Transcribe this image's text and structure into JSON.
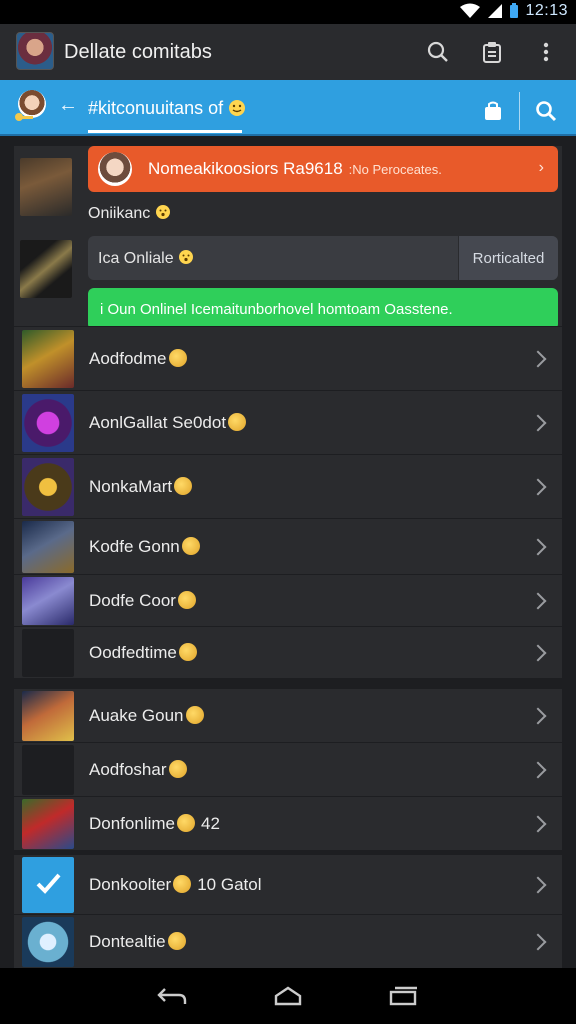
{
  "status": {
    "time": "12:13"
  },
  "appbar": {
    "title": "Dellate comitabs"
  },
  "tab": {
    "title": "#kitconuuitans of"
  },
  "banners": {
    "orange": {
      "title": "Nomeakikoosiors Ra9618",
      "sub": ":No Peroceates."
    },
    "online_label": "Oniikanc",
    "gray": {
      "text": "Ica Onliale",
      "button": "Rorticalted"
    },
    "green": {
      "text": "i Oun Onlinel Icemaitunborhovel homtoam Oasstene."
    }
  },
  "rows": [
    {
      "name": "Aodfodme",
      "extra": ""
    },
    {
      "name": "AonlGallat Se0dot",
      "extra": ""
    },
    {
      "name": "NonkaMart",
      "extra": ""
    },
    {
      "name": "Kodfe Gonn",
      "extra": ""
    },
    {
      "name": "Dodfe Coor",
      "extra": ""
    },
    {
      "name": "Oodfedtime",
      "extra": ""
    },
    {
      "name": "Auake Goun",
      "extra": ""
    },
    {
      "name": "Aodfoshar",
      "extra": ""
    },
    {
      "name": "Donfonlime",
      "extra": "42"
    },
    {
      "name": "Donkoolter",
      "extra": "10 Gatol"
    },
    {
      "name": "Dontealtie",
      "extra": ""
    }
  ],
  "colors": {
    "accent": "#2f9fe0",
    "banner_orange": "#e85a2a",
    "banner_green": "#2fcf5a",
    "surface": "#2a2b2e",
    "background": "#1d1e21"
  },
  "icons": {
    "appbar": [
      "search-icon",
      "clipboard-icon",
      "more-vert-icon"
    ],
    "tabbar": [
      "back-arrow-icon",
      "bag-icon",
      "search-icon"
    ],
    "navbar": [
      "back-icon",
      "home-icon",
      "recents-icon"
    ]
  }
}
